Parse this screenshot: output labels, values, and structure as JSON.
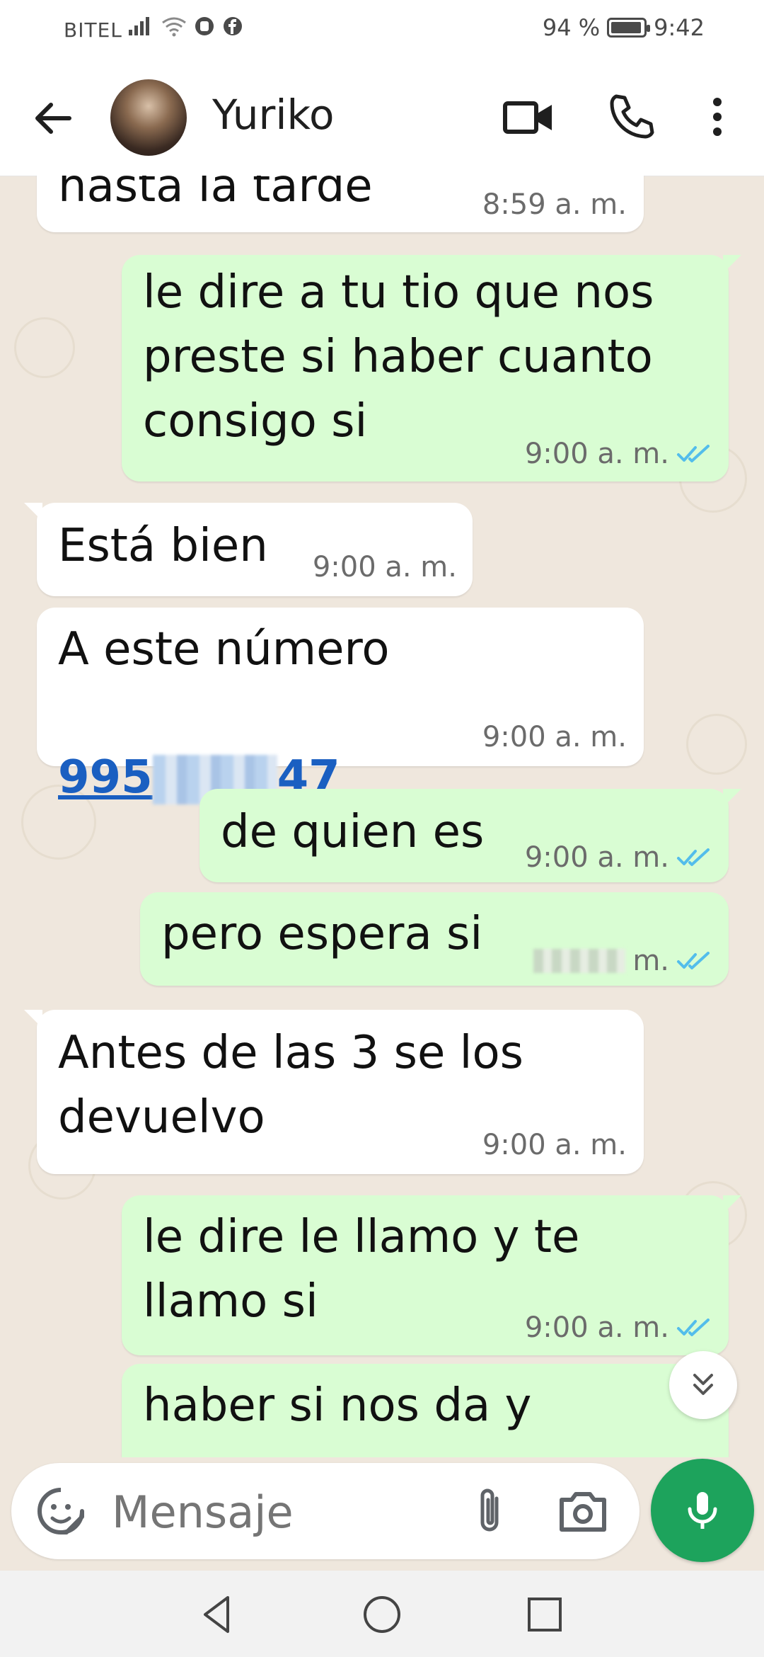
{
  "status_bar": {
    "carrier": "BITEL",
    "battery": "94 %",
    "battery_level": 0.94,
    "time": "9:42"
  },
  "header": {
    "contact_name": "Yuriko"
  },
  "messages": [
    {
      "dir": "in",
      "text": "hasta la tarde",
      "time": "8:59 a. m."
    },
    {
      "dir": "out",
      "text": "le dire a tu tio que nos\npreste si haber cuanto\nconsigo si",
      "time": "9:00 a. m."
    },
    {
      "dir": "in",
      "text": "Está bien",
      "time": "9:00 a. m."
    },
    {
      "dir": "in",
      "text": "A este número",
      "phone_prefix": "995",
      "phone_suffix": "47",
      "time": "9:00 a. m."
    },
    {
      "dir": "out",
      "text": "de quien es",
      "time": "9:00 a. m."
    },
    {
      "dir": "out",
      "text": "pero espera si",
      "time": "m."
    },
    {
      "dir": "in",
      "text": "Antes de las 3 se los\ndevuelvo",
      "time": "9:00 a. m."
    },
    {
      "dir": "out",
      "text": "le dire le llamo y te\nllamo si",
      "time": "9:00 a. m."
    },
    {
      "dir": "out",
      "text": "haber si nos da y",
      "time": ""
    }
  ],
  "input": {
    "placeholder": "Mensaje"
  },
  "colors": {
    "outgoing": "#d9fdd3",
    "incoming": "#ffffff",
    "read_ticks": "#53bdeb",
    "mic": "#1da35c",
    "wallpaper": "#efe7dd"
  },
  "icons": [
    "back-arrow-icon",
    "video-call-icon",
    "phone-icon",
    "more-vert-icon",
    "double-check-icon",
    "chevron-double-down-icon",
    "sticker-icon",
    "paperclip-icon",
    "camera-icon",
    "mic-icon",
    "nav-back-icon",
    "nav-home-icon",
    "nav-recents-icon"
  ]
}
